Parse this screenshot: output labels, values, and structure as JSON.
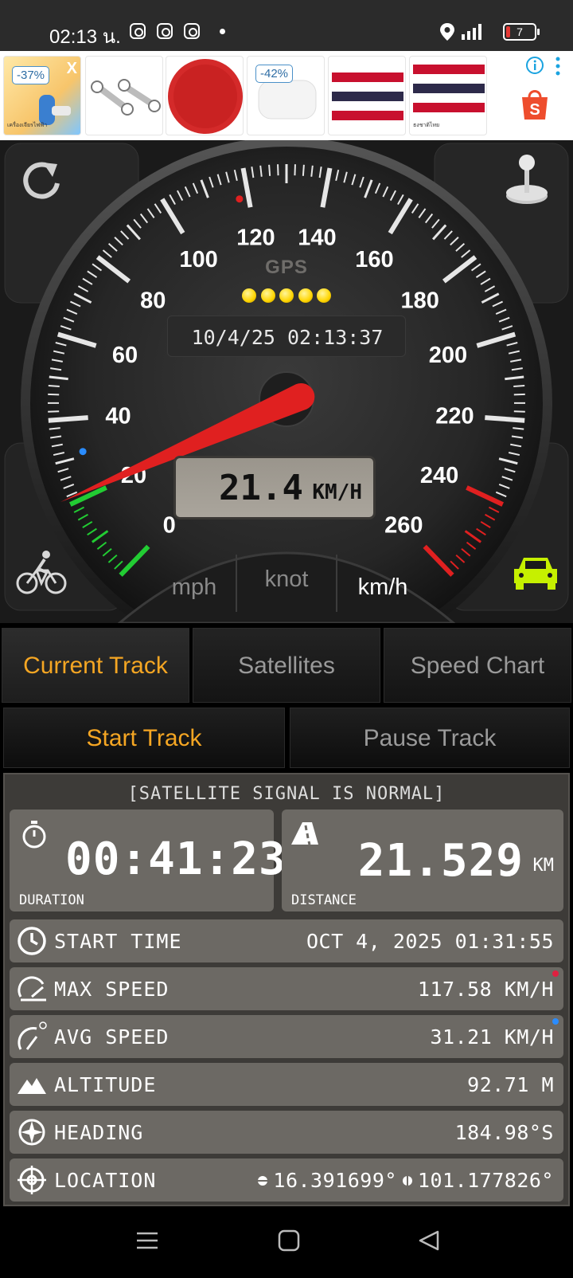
{
  "status_bar": {
    "time": "02:13 น.",
    "battery_level": "7",
    "icons": [
      "instagram-icon",
      "instagram-icon",
      "instagram-icon",
      "notification-dot-icon",
      "location-icon",
      "signal-icon",
      "battery-icon"
    ]
  },
  "ad_banner": {
    "close_label": "X",
    "items": [
      {
        "badge": "-37%",
        "caption": "เครื่องเจียรไฟฟ้า"
      },
      {
        "badge": "",
        "caption": ""
      },
      {
        "badge": "",
        "caption": ""
      },
      {
        "badge": "-42%",
        "caption": ""
      },
      {
        "badge": "",
        "caption": ""
      },
      {
        "badge": "",
        "caption": "ธงชาติไทย"
      }
    ],
    "colors": {
      "thai_red": "#c8102e",
      "thai_blue": "#2d2a4a",
      "shopee": "#ee4d2d"
    }
  },
  "speedometer": {
    "gps_label": "GPS",
    "gps_signal_dots": 5,
    "datetime": "10/4/25 02:13:37",
    "speed_value": "21.4",
    "speed_unit": "KM/H",
    "current_speed": 21.4,
    "max_speed_marker": 117.58,
    "avg_speed_marker": 31.21,
    "scale_max": 260,
    "scale_labels": [
      "0",
      "20",
      "40",
      "60",
      "80",
      "100",
      "120",
      "140",
      "160",
      "180",
      "200",
      "220",
      "240",
      "260"
    ],
    "units": {
      "mph": "mph",
      "knot": "knot",
      "kmh": "km/h"
    },
    "active_unit": "km/h",
    "colors": {
      "needle": "#e02020",
      "low_zone": "#22cc33",
      "high_zone": "#e02020",
      "car_icon": "#c6f000"
    }
  },
  "tabs": [
    {
      "label": "Current Track",
      "active": true
    },
    {
      "label": "Satellites",
      "active": false
    },
    {
      "label": "Speed Chart",
      "active": false
    }
  ],
  "track_buttons": {
    "start": "Start Track",
    "pause": "Pause Track"
  },
  "track_info": {
    "signal_status": "[SATELLITE SIGNAL IS NORMAL]",
    "duration": {
      "value": "00:41:23",
      "caption": "DURATION"
    },
    "distance": {
      "value": "21.529",
      "unit": "KM",
      "caption": "DISTANCE"
    },
    "rows": [
      {
        "label": "START TIME",
        "value": "OCT 4, 2025 01:31:55"
      },
      {
        "label": "MAX SPEED",
        "value": "117.58 KM/H"
      },
      {
        "label": "AVG SPEED",
        "value": "31.21 KM/H"
      },
      {
        "label": "ALTITUDE",
        "value": "92.71 M"
      },
      {
        "label": "HEADING",
        "value": "184.98°S"
      },
      {
        "label": "LOCATION",
        "lat": "16.391699°",
        "lon": "101.177826°"
      }
    ]
  }
}
